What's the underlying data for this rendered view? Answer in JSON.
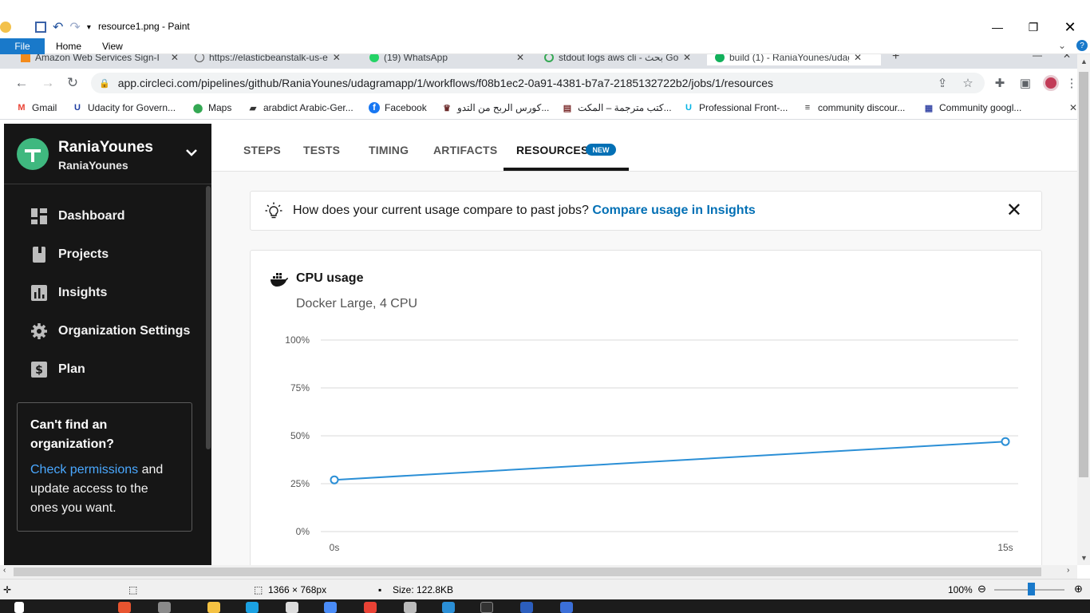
{
  "paint": {
    "title": "resource1.png - Paint",
    "ribbon_tabs": {
      "file": "File",
      "home": "Home",
      "view": "View"
    },
    "status": {
      "dimensions": "1366 × 768px",
      "size": "Size: 122.8KB",
      "zoom": "100%"
    }
  },
  "browser": {
    "tabs": [
      {
        "label": "Amazon Web Services Sign-I"
      },
      {
        "label": "https://elasticbeanstalk-us-e"
      },
      {
        "label": "(19) WhatsApp"
      },
      {
        "label": "stdout logs aws cli - بحث Go"
      },
      {
        "label": "build (1) - RaniaYounes/udag"
      }
    ],
    "url": "app.circleci.com/pipelines/github/RaniaYounes/udagramapp/1/workflows/f08b1ec2-0a91-4381-b7a7-2185132722b2/jobs/1/resources",
    "bookmarks": [
      {
        "label": "Gmail"
      },
      {
        "label": "Udacity for Govern..."
      },
      {
        "label": "Maps"
      },
      {
        "label": "arabdict Arabic-Ger..."
      },
      {
        "label": "Facebook"
      },
      {
        "label": "كورس الربح من التدو..."
      },
      {
        "label": "كتب مترجمة – المكت..."
      },
      {
        "label": "Professional Front-..."
      },
      {
        "label": "community discour..."
      },
      {
        "label": "Community googl..."
      }
    ]
  },
  "sidebar": {
    "org_name": "RaniaYounes",
    "org_sub": "RaniaYounes",
    "items": [
      {
        "label": "Dashboard"
      },
      {
        "label": "Projects"
      },
      {
        "label": "Insights"
      },
      {
        "label": "Organization Settings"
      },
      {
        "label": "Plan"
      }
    ],
    "org_box": {
      "title": "Can't find an organization?",
      "link": "Check permissions",
      "text": " and update access to the ones you want."
    }
  },
  "job_tabs": {
    "steps": "STEPS",
    "tests": "TESTS",
    "timing": "TIMING",
    "artifacts": "ARTIFACTS",
    "resources": "RESOURCES",
    "new_badge": "NEW"
  },
  "insight": {
    "question": "How does your current usage compare to past jobs? ",
    "link": "Compare usage in Insights"
  },
  "cpu_card": {
    "title": "CPU usage",
    "subtitle": "Docker Large, 4 CPU"
  },
  "colors": {
    "accent": "#0370b5",
    "line": "#2b8fd6",
    "sidebar": "#161616"
  },
  "chart_data": {
    "type": "line",
    "x": [
      0,
      15
    ],
    "xtick_labels": [
      "0s",
      "15s"
    ],
    "yticks": [
      0,
      25,
      50,
      75,
      100
    ],
    "ytick_labels": [
      "0%",
      "25%",
      "50%",
      "75%",
      "100%"
    ],
    "ylim": [
      0,
      100
    ],
    "series": [
      {
        "values": [
          27,
          47
        ]
      }
    ],
    "grid": true
  }
}
